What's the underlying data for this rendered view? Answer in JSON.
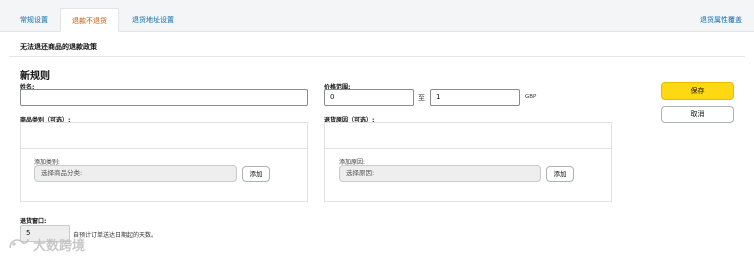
{
  "tabs": [
    "常规设置",
    "退款不退货",
    "退货地址设置"
  ],
  "tab_right": "退货属性覆盖",
  "policy_title": "无法退还商品的退款政策",
  "rule_heading": "新规则",
  "name_label": "姓名:",
  "name_value": "",
  "price_range_label": "价格范围:",
  "price_from": "0",
  "price_to_sep": "至",
  "price_to": "1",
  "currency": "GBP",
  "save_label": "保存",
  "cancel_label": "取消",
  "category_label": "商品类别（可选）:",
  "reason_label": "退货原因（可选）:",
  "add_category_label": "添加类别:",
  "category_placeholder": "选择商品分类:",
  "add_reason_label": "添加原因:",
  "reason_placeholder": "选择原因:",
  "add_button": "添加",
  "return_window_label": "退货窗口:",
  "return_window_value": "5",
  "return_window_suffix": "自预计订单送达日期起的天数。",
  "watermark_text": "大数跨境"
}
